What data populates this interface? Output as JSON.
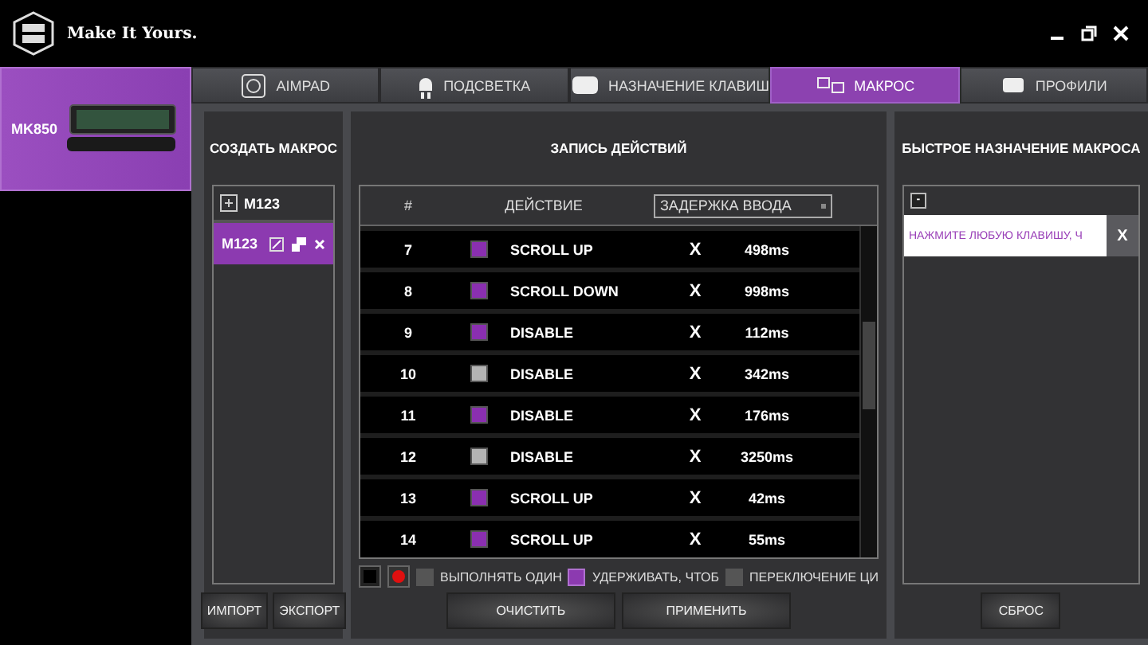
{
  "brand": {
    "tagline": "Make It Yours."
  },
  "device": {
    "name": "MK850",
    "selected": true
  },
  "tabs": [
    {
      "label": "AIMPAD",
      "kind": "crosshair",
      "selected": false
    },
    {
      "label": "ПОДСВЕТКА",
      "kind": "bulb",
      "selected": false
    },
    {
      "label": "НАЗНАЧЕНИЕ КЛАВИШ",
      "kind": "key",
      "selected": false
    },
    {
      "label": "МАКРОС",
      "kind": "macro",
      "selected": true
    },
    {
      "label": "ПРОФИЛИ",
      "kind": "profile",
      "selected": false
    }
  ],
  "create_panel": {
    "title": "СОЗДАТЬ МАКРОС",
    "new_label": "M123",
    "macros": [
      {
        "name": "M123",
        "selected": true
      }
    ],
    "buttons": [
      "ИМПОРТ",
      "ЭКСПОРТ"
    ]
  },
  "record_panel": {
    "title": "ЗАПИСЬ ДЕЙСТВИЙ",
    "columns": [
      "#",
      "ДЕЙСТВИЕ"
    ],
    "delay_dropdown": "ЗАДЕРЖКА ВВОДА",
    "rows": [
      {
        "index": "7",
        "color": "#8a2fb0",
        "action": "SCROLL UP",
        "remove": "X",
        "delay": "498ms"
      },
      {
        "index": "8",
        "color": "#8a2fb0",
        "action": "SCROLL DOWN",
        "remove": "X",
        "delay": "998ms"
      },
      {
        "index": "9",
        "color": "#8a2fb0",
        "action": "DISABLE",
        "remove": "X",
        "delay": "112ms"
      },
      {
        "index": "10",
        "color": "#b4b4b4",
        "action": "DISABLE",
        "remove": "X",
        "delay": "342ms"
      },
      {
        "index": "11",
        "color": "#8a2fb0",
        "action": "DISABLE",
        "remove": "X",
        "delay": "176ms"
      },
      {
        "index": "12",
        "color": "#b4b4b4",
        "action": "DISABLE",
        "remove": "X",
        "delay": "3250ms"
      },
      {
        "index": "13",
        "color": "#8a2fb0",
        "action": "SCROLL UP",
        "remove": "X",
        "delay": "42ms"
      },
      {
        "index": "14",
        "color": "#8a2fb0",
        "action": "SCROLL UP",
        "remove": "X",
        "delay": "55ms"
      }
    ],
    "options": [
      {
        "label": "ВЫПОЛНЯТЬ ОДИН",
        "checked": false
      },
      {
        "label": "УДЕРЖИВАТЬ, ЧТОБ",
        "checked": true
      },
      {
        "label": "ПЕРЕКЛЮЧЕНИЕ ЦИ",
        "checked": false
      }
    ],
    "buttons": [
      "ОЧИСТИТЬ",
      "ПРИМЕНИТЬ"
    ]
  },
  "assign_panel": {
    "title": "БЫСТРОЕ НАЗНАЧЕНИЕ МАКРОСА",
    "collapse": "-",
    "placeholder": "НАЖМИТЕ ЛЮБУЮ КЛАВИШУ, Ч",
    "clear": "X",
    "button": "СБРОС"
  }
}
